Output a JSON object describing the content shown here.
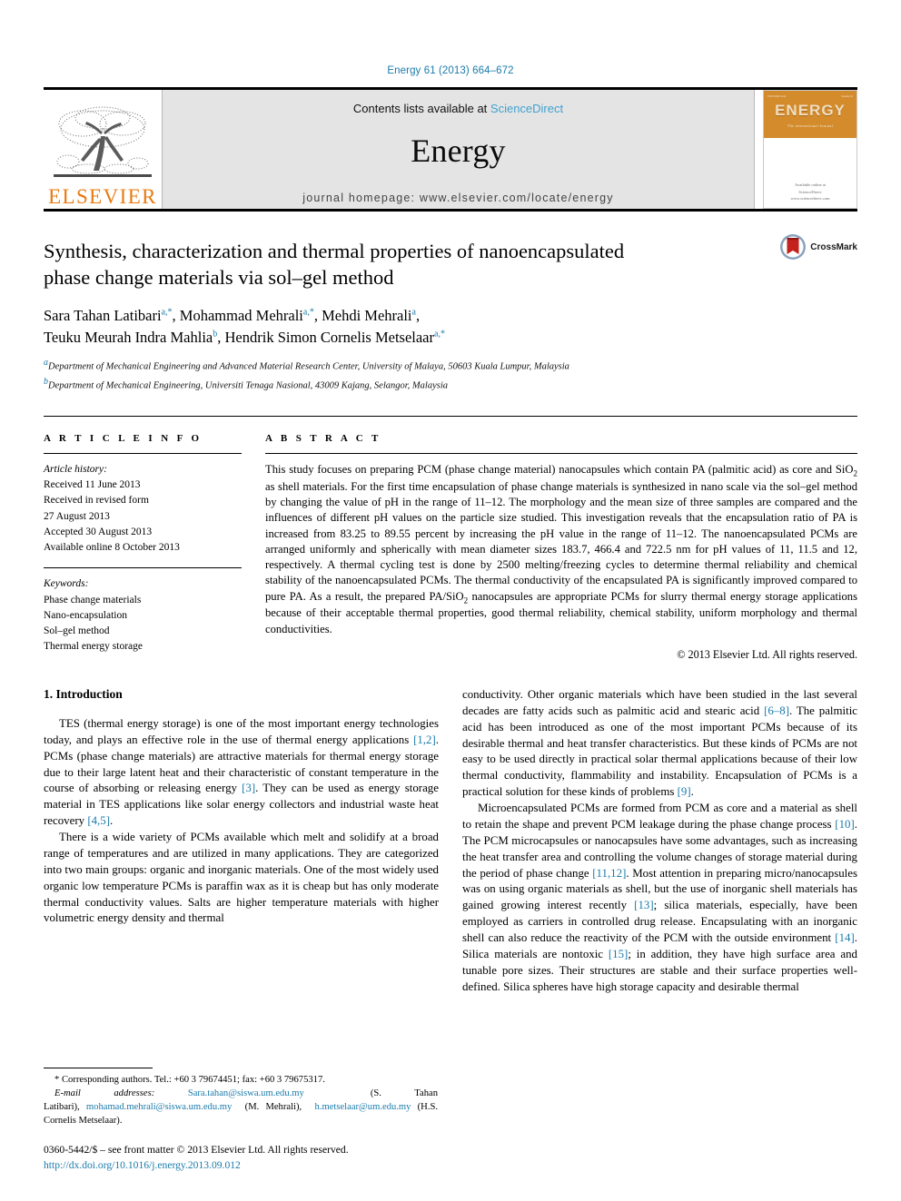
{
  "running_head": "Energy 61 (2013) 664–672",
  "masthead": {
    "publisher_name": "ELSEVIER",
    "contents_prefix": "Contents lists available at ",
    "contents_link": "ScienceDirect",
    "journal_title": "Energy",
    "homepage": "journal homepage: www.elsevier.com/locate/energy",
    "cover": {
      "band_word": "ENERGY",
      "band_sub": "The international Journal",
      "micro_left": "ISSN 0360-5442",
      "micro_right": "Volume 61",
      "foot_line1": "Available online at",
      "foot_line2": "ScienceDirect",
      "foot_line3": "www.sciencedirect.com"
    }
  },
  "article": {
    "title": "Synthesis, characterization and thermal properties of nanoencapsulated phase change materials via sol–gel method",
    "crossmark_label": "CrossMark",
    "authors_line1": "Sara Tahan Latibari",
    "authors_line1_sup": "a,*",
    "authors_line1b": ", Mohammad Mehrali",
    "authors_line1b_sup": "a,*",
    "authors_line1c": ", Mehdi Mehrali",
    "authors_line1c_sup": "a",
    "authors_line1d": ",",
    "authors_line2": "Teuku Meurah Indra Mahlia",
    "authors_line2_sup": "b",
    "authors_line2b": ", Hendrik Simon Cornelis Metselaar",
    "authors_line2b_sup": "a,*",
    "affiliations": [
      {
        "marker": "a",
        "text": "Department of Mechanical Engineering and Advanced Material Research Center, University of Malaya, 50603 Kuala Lumpur, Malaysia"
      },
      {
        "marker": "b",
        "text": "Department of Mechanical Engineering, Universiti Tenaga Nasional, 43009 Kajang, Selangor, Malaysia"
      }
    ]
  },
  "article_info": {
    "heading": "A R T I C L E   I N F O",
    "history_label": "Article history:",
    "history": [
      "Received 11 June 2013",
      "Received in revised form",
      "27 August 2013",
      "Accepted 30 August 2013",
      "Available online 8 October 2013"
    ],
    "keywords_label": "Keywords:",
    "keywords": [
      "Phase change materials",
      "Nano-encapsulation",
      "Sol–gel method",
      "Thermal energy storage"
    ]
  },
  "abstract": {
    "heading": "A B S T R A C T",
    "part1": "This study focuses on preparing PCM (phase change material) nanocapsules which contain PA (palmitic acid) as core and SiO",
    "sub1": "2",
    "part2": " as shell materials. For the first time encapsulation of phase change materials is synthesized in nano scale via the sol–gel method by changing the value of pH in the range of 11–12. The morphology and the mean size of three samples are compared and the influences of different pH values on the particle size studied. This investigation reveals that the encapsulation ratio of PA is increased from 83.25 to 89.55 percent by increasing the pH value in the range of 11–12. The nanoencapsulated PCMs are arranged uniformly and spherically with mean diameter sizes 183.7, 466.4 and 722.5 nm for pH values of 11, 11.5 and 12, respectively. A thermal cycling test is done by 2500 melting/freezing cycles to determine thermal reliability and chemical stability of the nanoencapsulated PCMs. The thermal conductivity of the encapsulated PA is significantly improved compared to pure PA. As a result, the prepared PA/SiO",
    "sub2": "2",
    "part3": " nanocapsules are appropriate PCMs for slurry thermal energy storage applications because of their acceptable thermal properties, good thermal reliability, chemical stability, uniform morphology and thermal conductivities.",
    "copyright": "© 2013 Elsevier Ltd. All rights reserved."
  },
  "introduction": {
    "section_number_title": "1. Introduction",
    "left_para1_a": "TES (thermal energy storage) is one of the most important energy technologies today, and plays an effective role in the use of thermal energy applications ",
    "left_para1_ref1": "[1,2]",
    "left_para1_b": ". PCMs (phase change materials) are attractive materials for thermal energy storage due to their large latent heat and their characteristic of constant temperature in the course of absorbing or releasing energy ",
    "left_para1_ref2": "[3]",
    "left_para1_c": ". They can be used as energy storage material in TES applications like solar energy collectors and industrial waste heat recovery ",
    "left_para1_ref3": "[4,5]",
    "left_para1_d": ".",
    "left_para2": "There is a wide variety of PCMs available which melt and solidify at a broad range of temperatures and are utilized in many applications. They are categorized into two main groups: organic and inorganic materials. One of the most widely used organic low temperature PCMs is paraffin wax as it is cheap but has only moderate thermal conductivity values. Salts are higher temperature materials with higher volumetric energy density and thermal",
    "right_para1_a": "conductivity. Other organic materials which have been studied in the last several decades are fatty acids such as palmitic acid and stearic acid ",
    "right_para1_ref1": "[6–8]",
    "right_para1_b": ". The palmitic acid has been introduced as one of the most important PCMs because of its desirable thermal and heat transfer characteristics. But these kinds of PCMs are not easy to be used directly in practical solar thermal applications because of their low thermal conductivity, flammability and instability. Encapsulation of PCMs is a practical solution for these kinds of problems ",
    "right_para1_ref2": "[9]",
    "right_para1_c": ".",
    "right_para2_a": "Microencapsulated PCMs are formed from PCM as core and a material as shell to retain the shape and prevent PCM leakage during the phase change process ",
    "right_para2_ref1": "[10]",
    "right_para2_b": ". The PCM microcapsules or nanocapsules have some advantages, such as increasing the heat transfer area and controlling the volume changes of storage material during the period of phase change ",
    "right_para2_ref2": "[11,12]",
    "right_para2_c": ". Most attention in preparing micro/nanocapsules was on using organic materials as shell, but the use of inorganic shell materials has gained growing interest recently ",
    "right_para2_ref3": "[13]",
    "right_para2_d": "; silica materials, especially, have been employed as carriers in controlled drug release. Encapsulating with an inorganic shell can also reduce the reactivity of the PCM with the outside environment ",
    "right_para2_ref4": "[14]",
    "right_para2_e": ". Silica materials are nontoxic ",
    "right_para2_ref5": "[15]",
    "right_para2_f": "; in addition, they have high surface area and tunable pore sizes. Their structures are stable and their surface properties well-defined. Silica spheres have high storage capacity and desirable thermal"
  },
  "footnotes": {
    "corresponding": "* Corresponding authors. Tel.: +60 3 79674451; fax: +60 3 79675317.",
    "email_label": "E-mail addresses:",
    "email1": "Sara.tahan@siswa.um.edu.my",
    "email1_owner": "(S. Tahan Latibari),",
    "email2": "mohamad.mehrali@siswa.um.edu.my",
    "email2_owner": "(M. Mehrali),",
    "email3": "h.metselaar@um.edu.my",
    "email3_owner": "(H.S. Cornelis Metselaar).",
    "issn_line": "0360-5442/$ – see front matter © 2013 Elsevier Ltd. All rights reserved.",
    "doi": "http://dx.doi.org/10.1016/j.energy.2013.09.012"
  },
  "colors": {
    "link": "#1a7bab",
    "sciencedirect": "#3fa2cf",
    "elsevier_orange": "#e87b10",
    "cover_band": "#d38b2b",
    "masthead_grey": "#e4e4e4"
  }
}
